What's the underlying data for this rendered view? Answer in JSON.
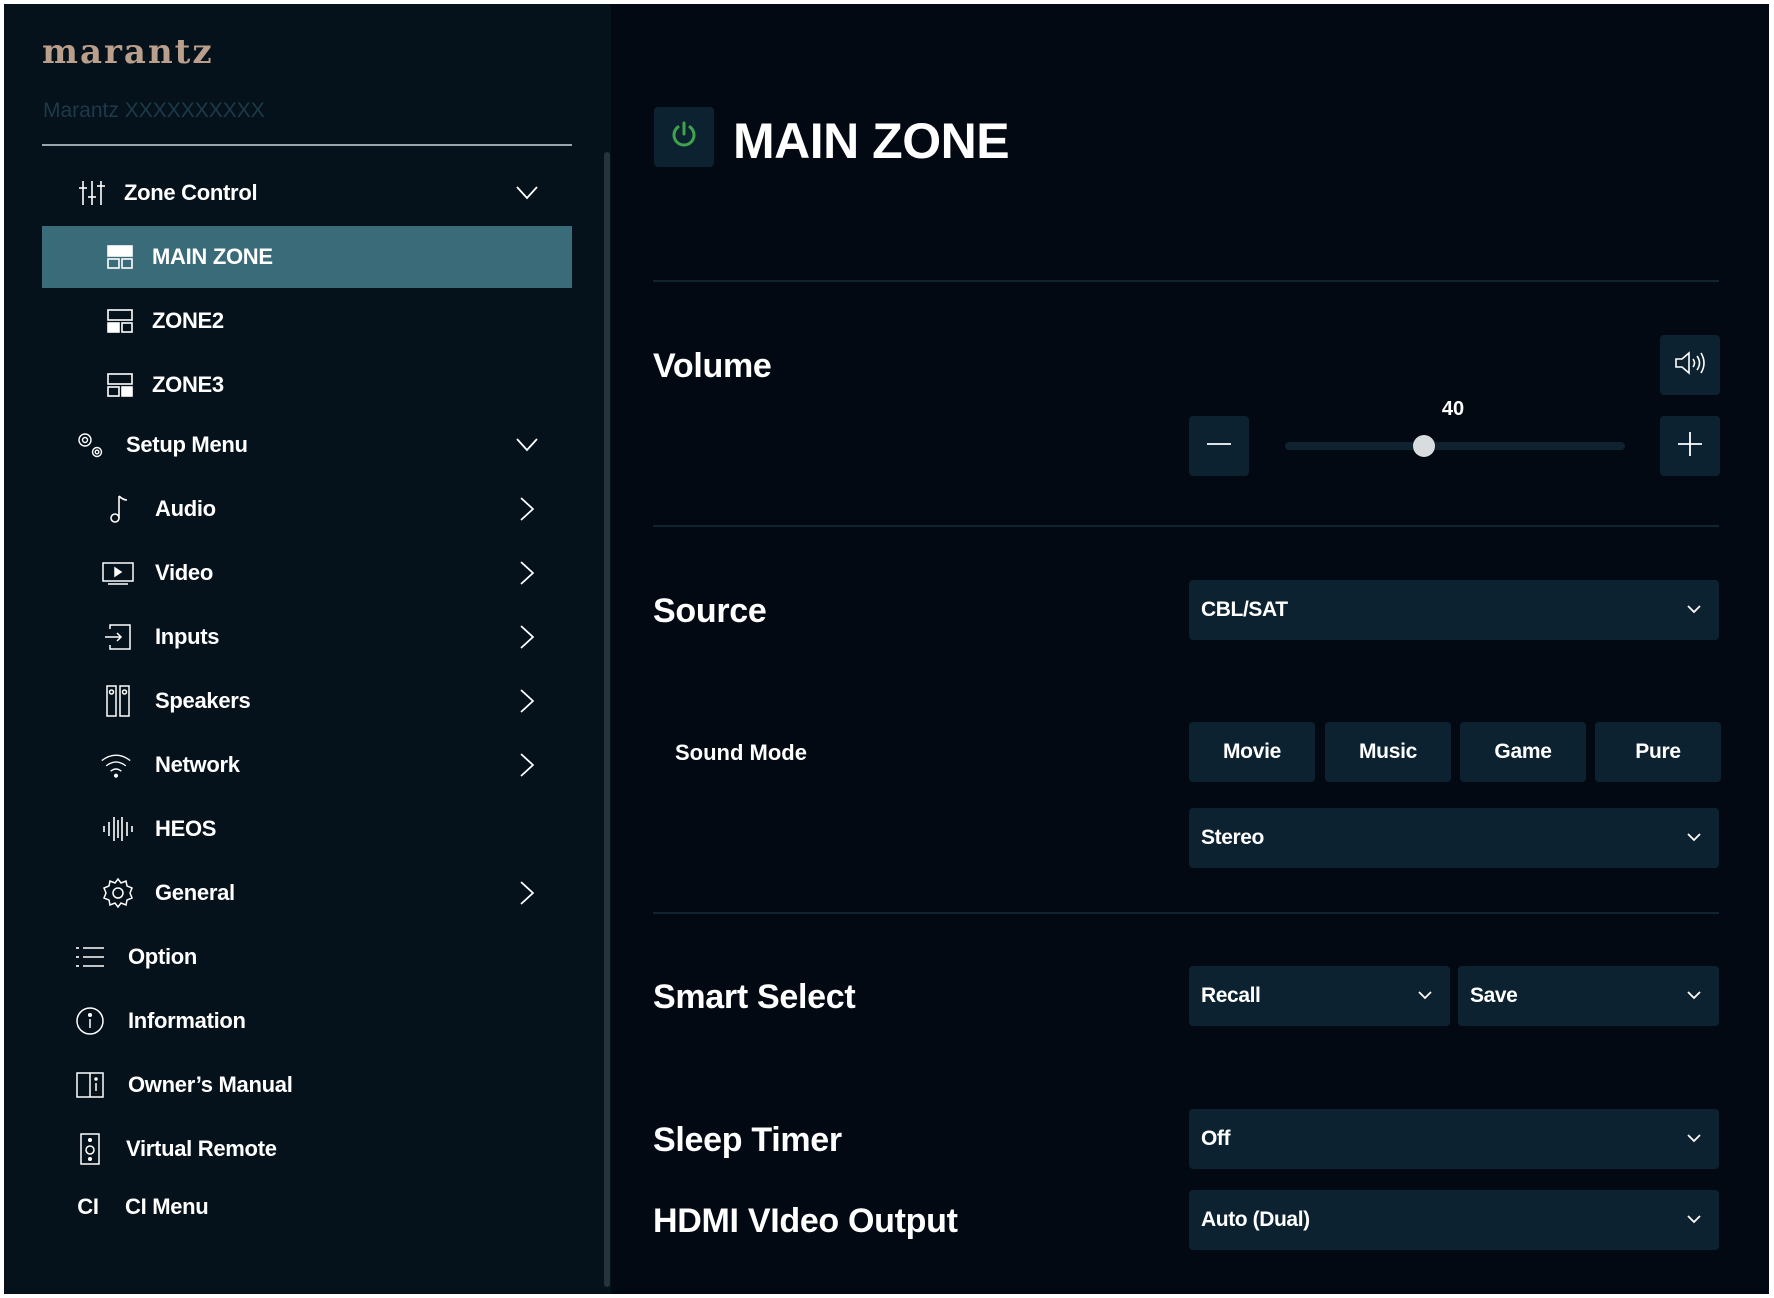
{
  "colors": {
    "background": "#020912",
    "sidebar": "#05111b",
    "active": "#3a6b78",
    "control": "#0d2230",
    "logo": "#b99f8c",
    "power": "#3fa34d"
  },
  "sidebar": {
    "logo": "marantz",
    "device_name": "Marantz XXXXXXXXXX",
    "zone_control": {
      "label": "Zone Control",
      "icon": "sliders-icon"
    },
    "zones": [
      {
        "label": "MAIN ZONE",
        "icon": "zone-icon",
        "active": true
      },
      {
        "label": "ZONE2",
        "icon": "zone-icon",
        "active": false
      },
      {
        "label": "ZONE3",
        "icon": "zone-icon",
        "active": false
      }
    ],
    "setup_menu": {
      "label": "Setup Menu",
      "icon": "gears-icon"
    },
    "setup_items": [
      {
        "label": "Audio",
        "icon": "music-note-icon"
      },
      {
        "label": "Video",
        "icon": "video-icon"
      },
      {
        "label": "Inputs",
        "icon": "input-icon"
      },
      {
        "label": "Speakers",
        "icon": "speakers-icon"
      },
      {
        "label": "Network",
        "icon": "wifi-icon"
      },
      {
        "label": "HEOS",
        "icon": "heos-icon"
      },
      {
        "label": "General",
        "icon": "gear-icon"
      }
    ],
    "bottom_items": [
      {
        "label": "Option",
        "icon": "list-icon"
      },
      {
        "label": "Information",
        "icon": "info-icon"
      },
      {
        "label": "Owner’s Manual",
        "icon": "book-icon"
      },
      {
        "label": "Virtual Remote",
        "icon": "remote-icon"
      },
      {
        "label": "CI Menu",
        "icon_text": "CI"
      }
    ]
  },
  "main": {
    "title": "MAIN ZONE",
    "volume": {
      "label": "Volume",
      "value": "40",
      "level": 40,
      "max": 98
    },
    "source": {
      "label": "Source",
      "value": "CBL/SAT"
    },
    "sound_mode": {
      "label": "Sound Mode",
      "buttons": [
        "Movie",
        "Music",
        "Game",
        "Pure"
      ],
      "value": "Stereo"
    },
    "smart_select": {
      "label": "Smart Select",
      "recall": "Recall",
      "save": "Save"
    },
    "sleep_timer": {
      "label": "Sleep Timer",
      "value": "Off"
    },
    "hdmi_output": {
      "label": "HDMI VIdeo Output",
      "value": "Auto (Dual)"
    }
  }
}
